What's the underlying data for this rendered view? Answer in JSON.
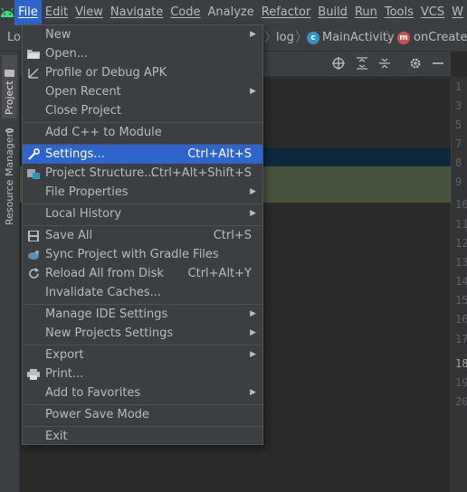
{
  "menubar": {
    "items": [
      {
        "label": "File",
        "active": true
      },
      {
        "label": "Edit"
      },
      {
        "label": "View"
      },
      {
        "label": "Navigate"
      },
      {
        "label": "Code"
      },
      {
        "label": "Analyze"
      },
      {
        "label": "Refactor"
      },
      {
        "label": "Build"
      },
      {
        "label": "Run"
      },
      {
        "label": "Tools"
      },
      {
        "label": "VCS"
      },
      {
        "label": "W"
      }
    ]
  },
  "navbar": {
    "project_crumb": "Lo",
    "crumbs": [
      "log",
      "MainActivity",
      "onCreate"
    ],
    "class_icon_letter": "c",
    "method_icon_letter": "m"
  },
  "left_strip": {
    "tabs": [
      "Project",
      "Resource Manager"
    ]
  },
  "gutter": {
    "line_numbers": [
      "1",
      "3",
      "5",
      "7",
      "8",
      "9",
      "10",
      "11",
      "12",
      "13",
      "14",
      "15",
      "16",
      "17",
      "18",
      "19",
      "20"
    ],
    "current_line": "18"
  },
  "file_menu": {
    "items": [
      {
        "label": "New",
        "submenu": true
      },
      {
        "label": "Open..."
      },
      {
        "label": "Profile or Debug APK"
      },
      {
        "label": "Open Recent",
        "submenu": true
      },
      {
        "label": "Close Project"
      },
      {
        "label": "Add C++ to Module"
      },
      {
        "label": "Settings...",
        "shortcut": "Ctrl+Alt+S",
        "selected": true
      },
      {
        "label": "Project Structure...",
        "shortcut": "Ctrl+Alt+Shift+S"
      },
      {
        "label": "File Properties",
        "submenu": true
      },
      {
        "label": "Local History",
        "submenu": true
      },
      {
        "label": "Save All",
        "shortcut": "Ctrl+S"
      },
      {
        "label": "Sync Project with Gradle Files"
      },
      {
        "label": "Reload All from Disk",
        "shortcut": "Ctrl+Alt+Y"
      },
      {
        "label": "Invalidate Caches..."
      },
      {
        "label": "Manage IDE Settings",
        "submenu": true
      },
      {
        "label": "New Projects Settings",
        "submenu": true
      },
      {
        "label": "Export",
        "submenu": true
      },
      {
        "label": "Print..."
      },
      {
        "label": "Add to Favorites",
        "submenu": true
      },
      {
        "label": "Power Save Mode"
      },
      {
        "label": "Exit"
      }
    ]
  },
  "colors": {
    "accent": "#2f65ca",
    "background": "#2b2b2b",
    "panel": "#3c3f41",
    "android_green": "#3ddc84"
  }
}
